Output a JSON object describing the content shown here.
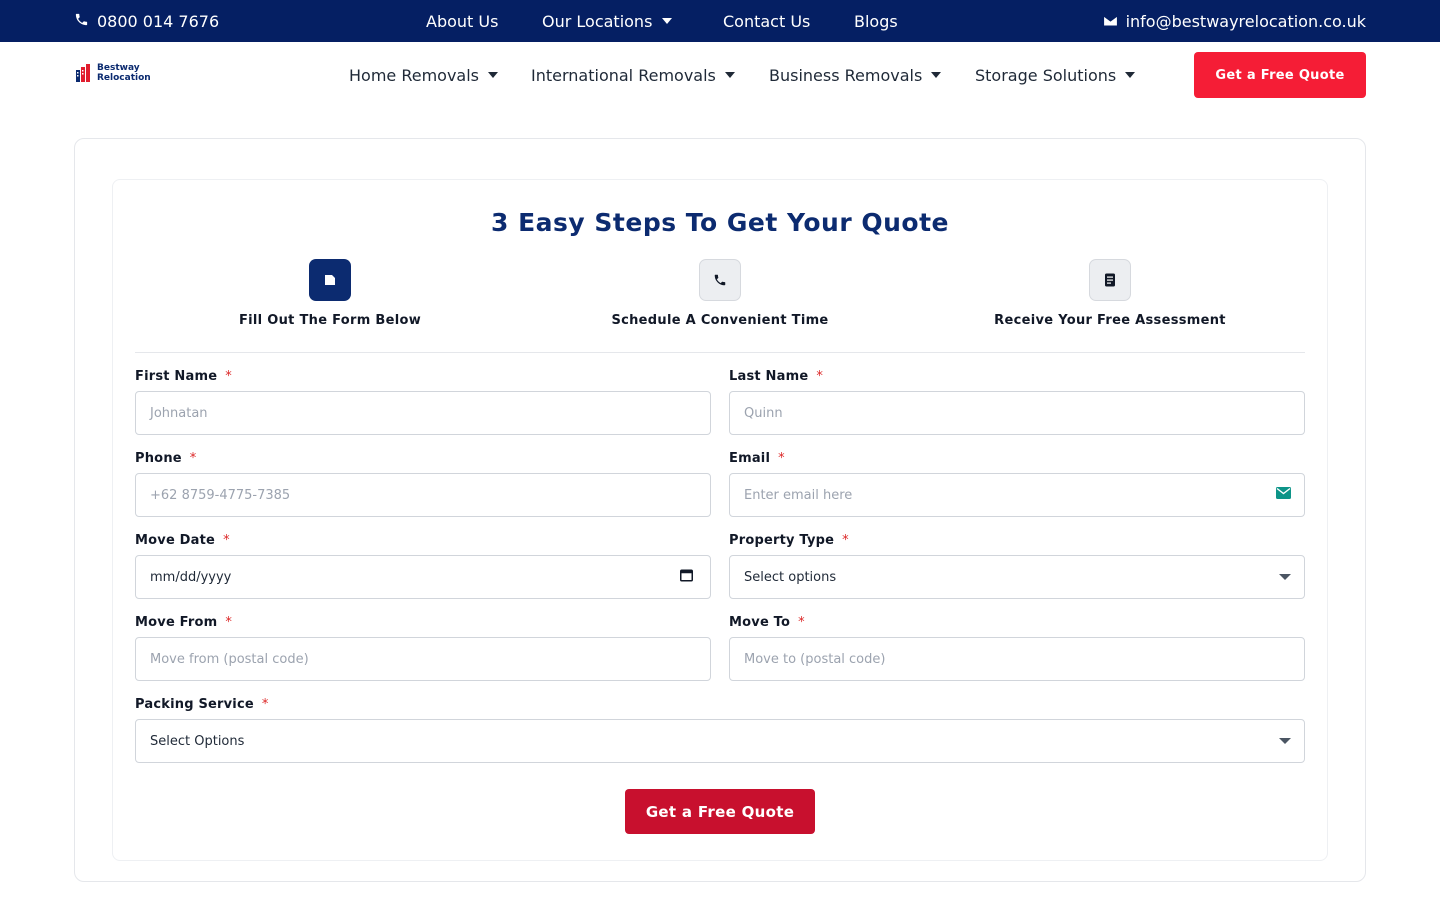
{
  "topbar": {
    "phone": "0800 014 7676",
    "nav": [
      {
        "label": "About Us"
      },
      {
        "label": "Our Locations"
      },
      {
        "label": "Contact Us"
      },
      {
        "label": "Blogs"
      }
    ],
    "email": "info@bestwayrelocation.co.uk"
  },
  "header": {
    "logo_line1": "Bestway",
    "logo_line2": "Relocation",
    "nav": [
      {
        "label": "Home Removals"
      },
      {
        "label": "International Removals"
      },
      {
        "label": "Business Removals"
      },
      {
        "label": "Storage Solutions"
      }
    ],
    "cta": "Get a Free Quote"
  },
  "form": {
    "title": "3 Easy Steps To Get Your Quote",
    "steps": [
      {
        "label": "Fill Out The Form Below",
        "icon": "document-icon"
      },
      {
        "label": "Schedule A Convenient Time",
        "icon": "phone-icon"
      },
      {
        "label": "Receive Your Free Assessment",
        "icon": "clipboard-icon"
      }
    ],
    "required_mark": "*",
    "fields": {
      "first_name": {
        "label": "First Name",
        "placeholder": "Johnatan"
      },
      "last_name": {
        "label": "Last Name",
        "placeholder": "Quinn"
      },
      "phone": {
        "label": "Phone",
        "placeholder": "+62 8759-4775-7385"
      },
      "email": {
        "label": "Email",
        "placeholder": "Enter email here"
      },
      "move_date": {
        "label": "Move Date",
        "value": "mm/dd/yyyy"
      },
      "property_type": {
        "label": "Property Type",
        "value": "Select options"
      },
      "move_from": {
        "label": "Move From",
        "placeholder": "Move from (postal code)"
      },
      "move_to": {
        "label": "Move To",
        "placeholder": "Move to (postal code)"
      },
      "packing_service": {
        "label": "Packing Service",
        "value": "Select Options"
      }
    },
    "submit": "Get a Free Quote"
  },
  "colors": {
    "navy": "#051f63",
    "title_navy": "#0c2b70",
    "cta_red": "#f51d36",
    "submit_red": "#c8102e",
    "email_icon_teal": "#0d9488"
  }
}
